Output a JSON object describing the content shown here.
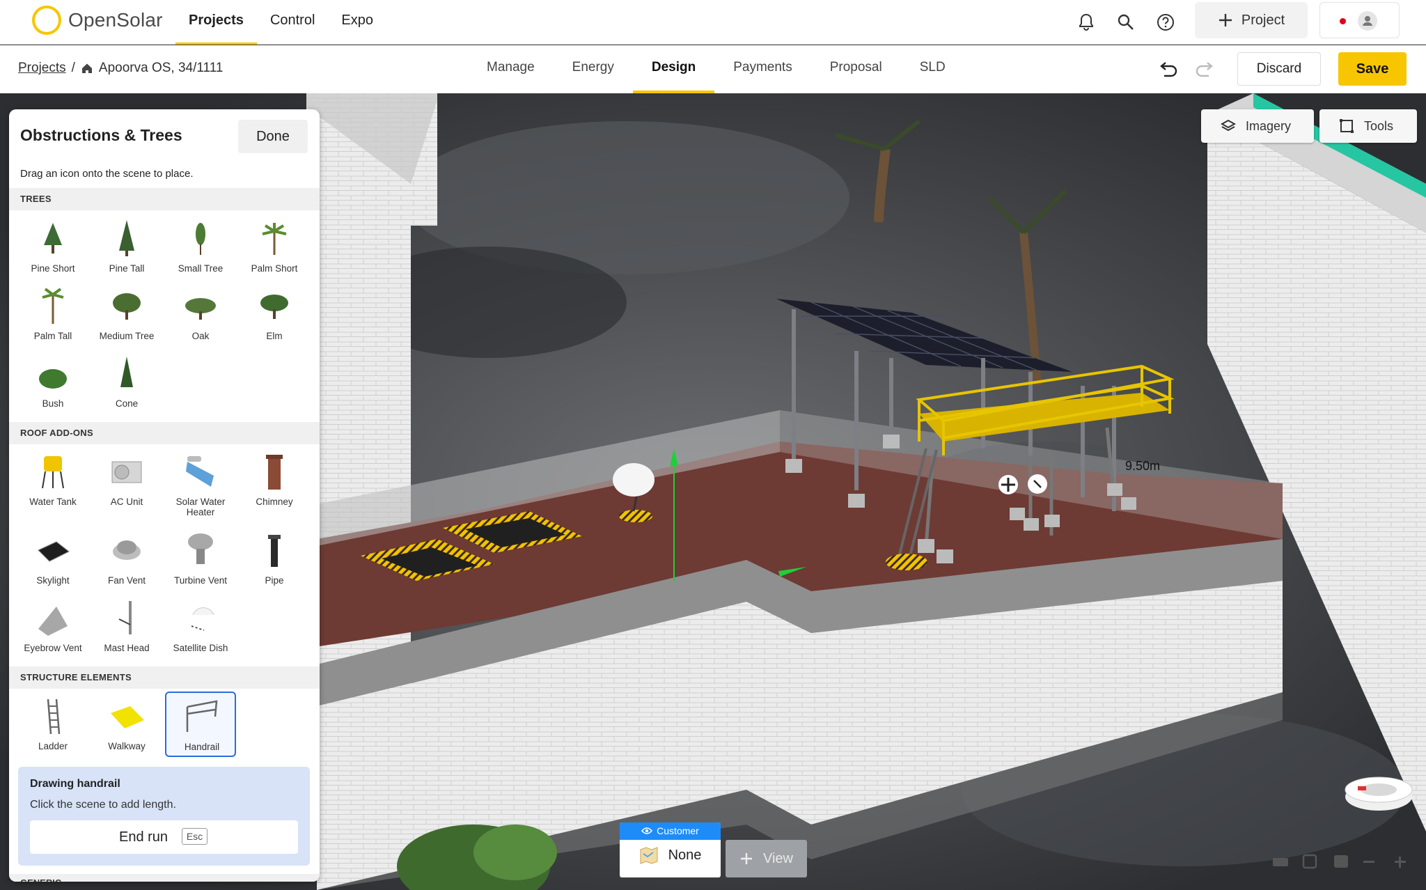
{
  "app": {
    "brand": "OpenSolar",
    "accent": "#f7c600"
  },
  "nav": {
    "items": [
      "Projects",
      "Control",
      "Expo"
    ],
    "active": "Projects"
  },
  "topbar": {
    "new_project_label": "Project"
  },
  "breadcrumb": {
    "root": "Projects",
    "separator": "/",
    "current": "Apoorva OS, 34/1111"
  },
  "tabs": {
    "items": [
      "Manage",
      "Energy",
      "Design",
      "Payments",
      "Proposal",
      "SLD"
    ],
    "active": "Design"
  },
  "actions": {
    "discard": "Discard",
    "save": "Save"
  },
  "scene_buttons": {
    "imagery": "Imagery",
    "tools": "Tools"
  },
  "panel": {
    "title": "Obstructions & Trees",
    "done": "Done",
    "hint": "Drag an icon onto the scene to place.",
    "sections": {
      "trees": {
        "title": "TREES",
        "items": [
          "Pine Short",
          "Pine Tall",
          "Small Tree",
          "Palm Short",
          "Palm Tall",
          "Medium Tree",
          "Oak",
          "Elm",
          "Bush",
          "Cone"
        ]
      },
      "roof": {
        "title": "ROOF ADD-ONS",
        "items": [
          "Water Tank",
          "AC Unit",
          "Solar Water Heater",
          "Chimney",
          "Skylight",
          "Fan Vent",
          "Turbine Vent",
          "Pipe",
          "Eyebrow Vent",
          "Mast Head",
          "Satellite Dish"
        ]
      },
      "structure": {
        "title": "STRUCTURE ELEMENTS",
        "items": [
          "Ladder",
          "Walkway",
          "Handrail"
        ],
        "selected": "Handrail"
      },
      "generic": {
        "title": "GENERIC"
      }
    },
    "drawing": {
      "title": "Drawing handrail",
      "subtitle": "Click the scene to add length.",
      "end_run": "End run",
      "key": "Esc"
    }
  },
  "view": {
    "tag": "Customer",
    "value": "None",
    "add_view": "View"
  },
  "measure": {
    "length": "9.50m"
  }
}
